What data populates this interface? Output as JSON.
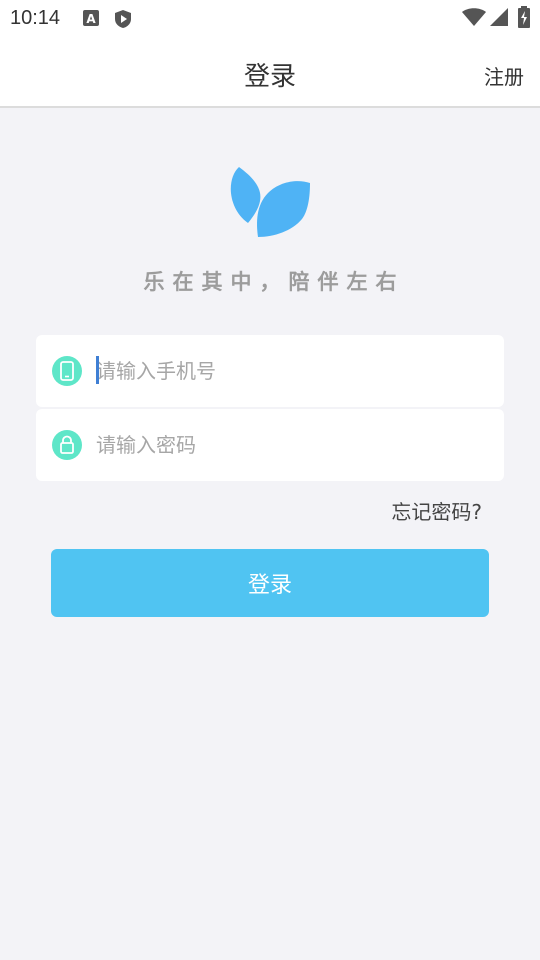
{
  "status_bar": {
    "time": "10:14",
    "left_icons": [
      "a-notification-icon",
      "shield-play-icon"
    ],
    "right_icons": [
      "wifi-icon",
      "cellular-signal-icon",
      "battery-charging-icon"
    ]
  },
  "header": {
    "title": "登录",
    "register_label": "注册"
  },
  "brand": {
    "logo_icon": "leaf-logo-icon",
    "slogan": "乐在其中，陪伴左右",
    "accent_color": "#4fb3f5"
  },
  "form": {
    "phone": {
      "icon": "mobile-phone-icon",
      "placeholder": "请输入手机号",
      "value": ""
    },
    "password": {
      "icon": "lock-icon",
      "placeholder": "请输入密码",
      "value": ""
    },
    "icon_color": "#5ee6c8",
    "forgot_label": "忘记密码?",
    "login_label": "登录",
    "button_color": "#50c4f2"
  }
}
